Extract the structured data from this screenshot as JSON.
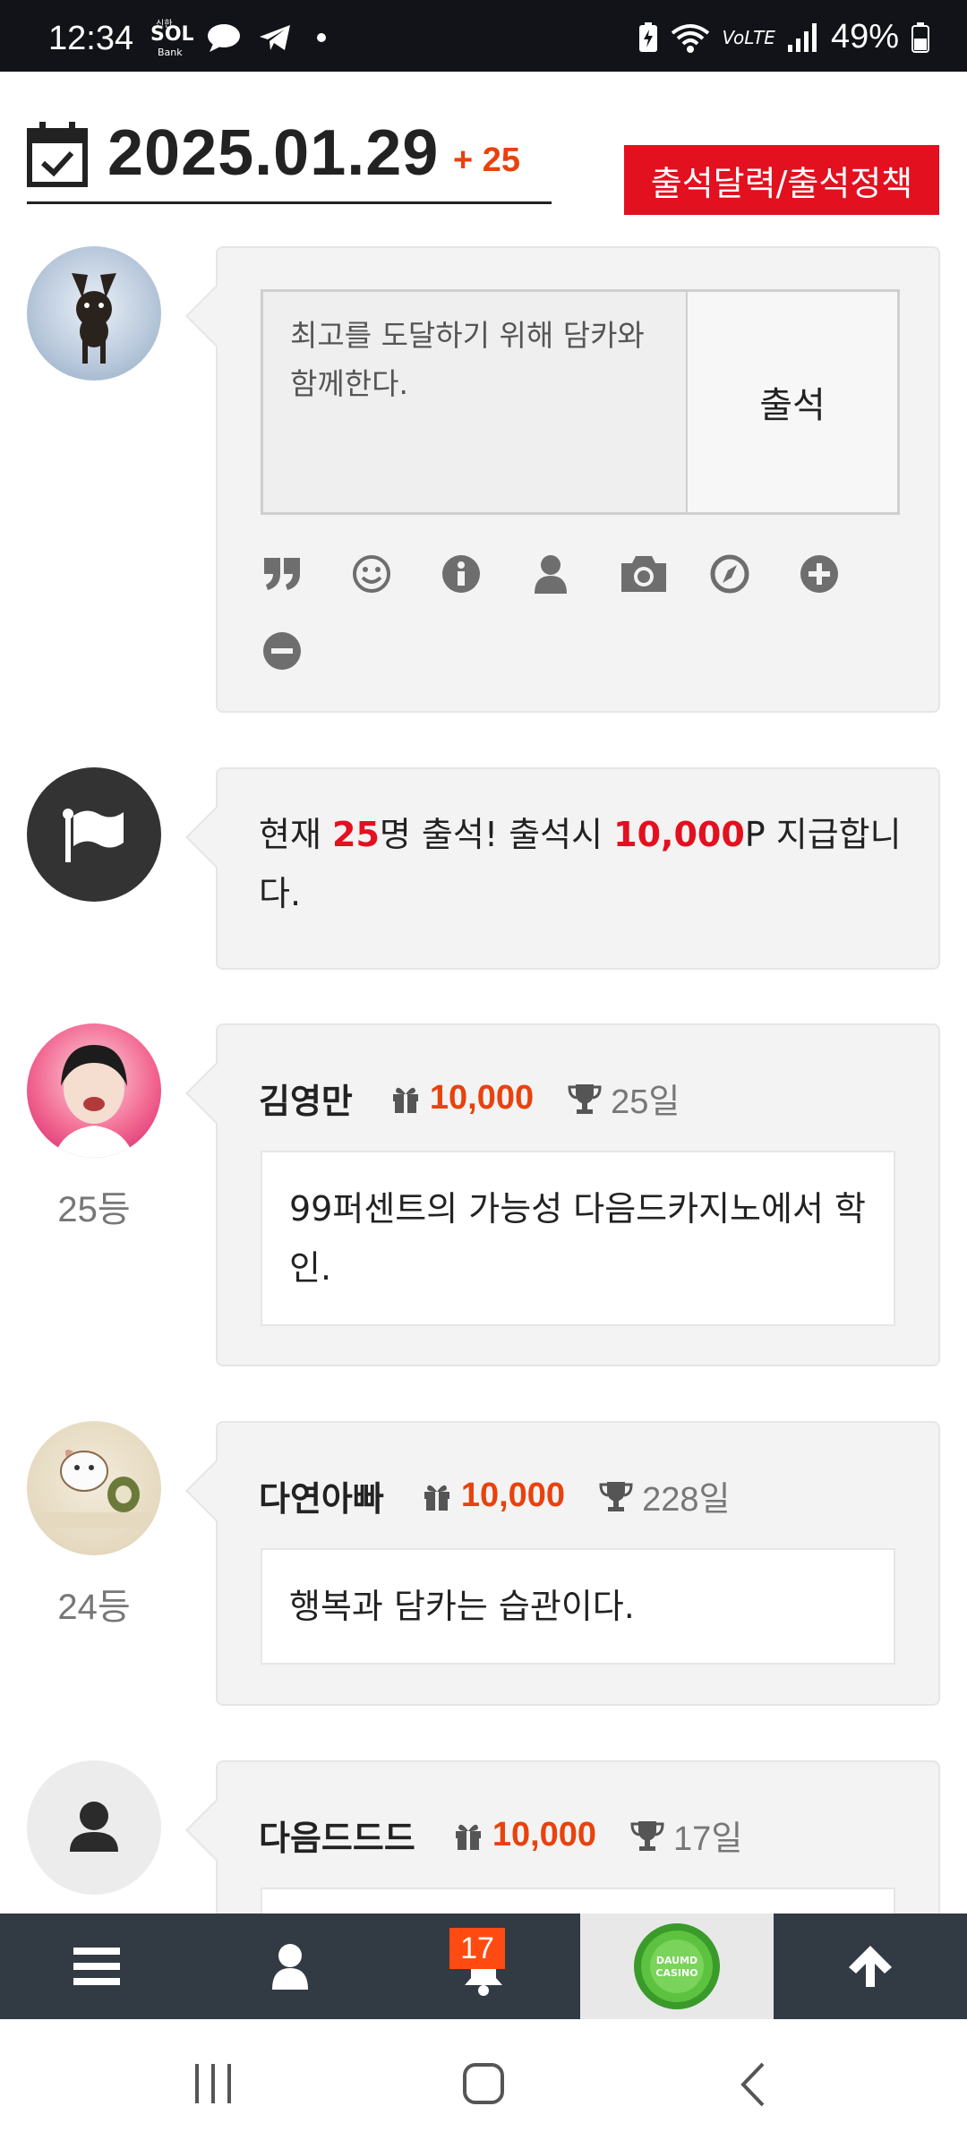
{
  "status_bar": {
    "time": "12:34",
    "bank_top": "신한",
    "bank_main": "SOL",
    "bank_bottom": "Bank",
    "network": "VoLTE",
    "battery": "49%"
  },
  "header": {
    "date": "2025.01.29",
    "count": "+ 25",
    "policy_button": "출석달력/출석정책"
  },
  "compose": {
    "text": "최고를 도달하기 위해 담카와 함께한다.",
    "submit_label": "출석",
    "toolbar_icons": [
      "quote-icon",
      "smile-icon",
      "info-icon",
      "user-icon",
      "camera-icon",
      "compass-icon",
      "plus-circle-icon",
      "minus-circle-icon"
    ]
  },
  "notice": {
    "prefix": "현재 ",
    "count": "25",
    "mid": "명 출석! 출석시 ",
    "points": "10,000",
    "suffix": "P 지급합니다."
  },
  "entries": [
    {
      "name": "김영만",
      "points": "10,000",
      "days": "25일",
      "rank": "25등",
      "message": "99퍼센트의 가능성 다음드카지노에서 학인."
    },
    {
      "name": "다연아빠",
      "points": "10,000",
      "days": "228일",
      "rank": "24등",
      "message": "행복과 담카는 습관이다."
    },
    {
      "name": "다음드드드",
      "points": "10,000",
      "days": "17일",
      "rank": "",
      "message": ""
    }
  ],
  "bottom_nav": {
    "badge": "17",
    "casino_logo_text": "DAUMD CASINO",
    "items": [
      "menu-icon",
      "user-icon",
      "bell-icon",
      "casino-logo",
      "arrow-up-icon"
    ]
  },
  "colors": {
    "accent_red": "#e3101f",
    "accent_orange": "#e8420e",
    "nav_bg": "#323a44"
  }
}
